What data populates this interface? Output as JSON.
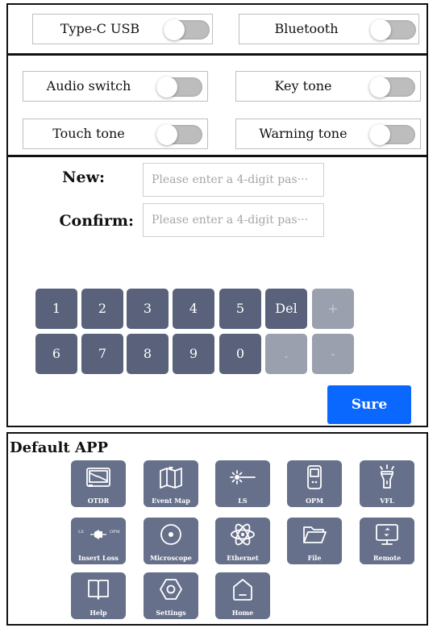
{
  "connections": {
    "type_c": {
      "label": "Type-C USB",
      "on": false
    },
    "bluetooth": {
      "label": "Bluetooth",
      "on": false
    }
  },
  "sounds": {
    "audio": {
      "label": "Audio switch",
      "on": false
    },
    "key_tone": {
      "label": "Key tone",
      "on": false
    },
    "touch_tone": {
      "label": "Touch tone",
      "on": false
    },
    "warning_tone": {
      "label": "Warning tone",
      "on": false
    }
  },
  "password": {
    "new_label": "New:",
    "confirm_label": "Confirm:",
    "new_placeholder": "Please enter a 4-digit pas···",
    "confirm_placeholder": "Please enter a 4-digit pas···"
  },
  "keypad": {
    "row1": [
      "1",
      "2",
      "3",
      "4",
      "5",
      "Del",
      "+"
    ],
    "row2": [
      "6",
      "7",
      "8",
      "9",
      "0",
      ".",
      "-"
    ]
  },
  "sure_label": "Sure",
  "apps": {
    "title": "Default APP",
    "items": [
      {
        "label": "OTDR",
        "icon": "otdr-icon"
      },
      {
        "label": "Event Map",
        "icon": "event-map-icon"
      },
      {
        "label": "LS",
        "icon": "laser-source-icon"
      },
      {
        "label": "OPM",
        "icon": "power-meter-icon"
      },
      {
        "label": "VFL",
        "icon": "flashlight-icon"
      },
      {
        "label": "Insert Loss",
        "icon": "insert-loss-icon"
      },
      {
        "label": "Microscope",
        "icon": "microscope-icon"
      },
      {
        "label": "Ethernet",
        "icon": "ethernet-icon"
      },
      {
        "label": "File",
        "icon": "folder-icon"
      },
      {
        "label": "Remote",
        "icon": "remote-icon"
      },
      {
        "label": "Help",
        "icon": "help-book-icon"
      },
      {
        "label": "Settings",
        "icon": "settings-icon"
      },
      {
        "label": "Home",
        "icon": "home-icon"
      }
    ],
    "insert_loss_left": "LS",
    "insert_loss_right": "OPM"
  }
}
